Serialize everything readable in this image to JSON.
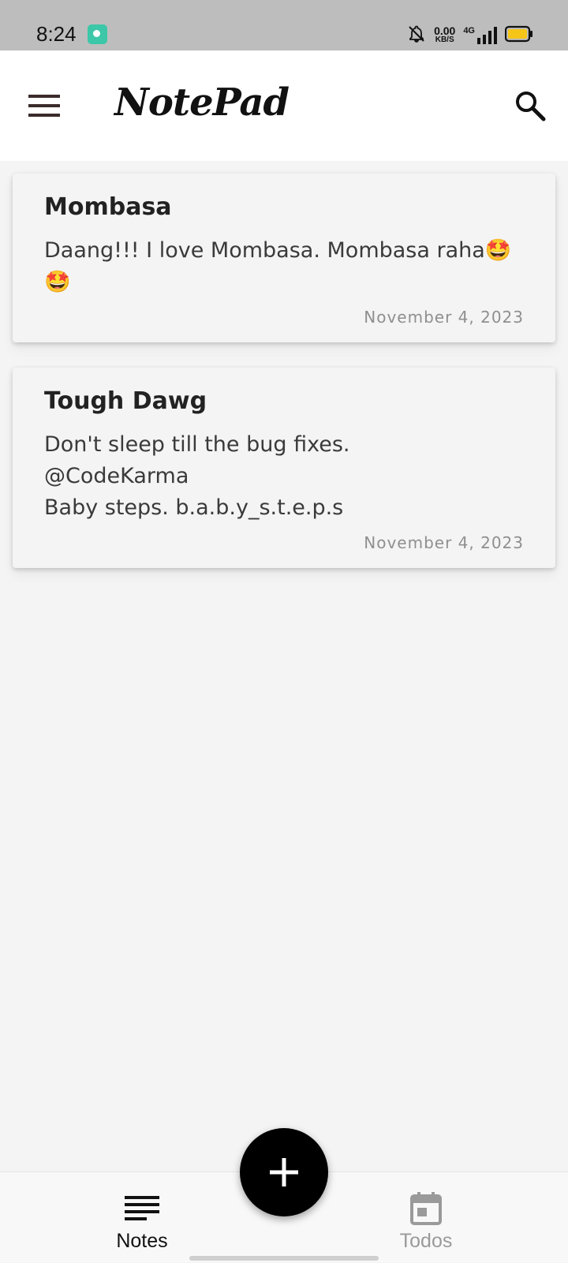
{
  "status_bar": {
    "time": "8:24",
    "net_speed_value": "0.00",
    "net_speed_unit": "KB/S",
    "network_type": "4G",
    "icons": [
      "app-notification-icon",
      "bell-off-icon",
      "signal-icon",
      "battery-icon"
    ],
    "battery_color": "#f5c518"
  },
  "app_bar": {
    "title": "NotePad",
    "menu_icon": "hamburger-menu-icon",
    "search_icon": "search-icon"
  },
  "notes": [
    {
      "title": "Mombasa",
      "body": "Daang!!! I love Mombasa. Mombasa raha🤩🤩",
      "date": "November 4, 2023"
    },
    {
      "title": "Tough Dawg",
      "body": "Don't sleep till the bug fixes.\n@CodeKarma\nBaby steps. b.a.b.y_s.t.e.p.s",
      "date": "November 4, 2023"
    }
  ],
  "fab": {
    "icon": "plus-icon"
  },
  "bottom_nav": {
    "items": [
      {
        "label": "Notes",
        "icon": "notes-lines-icon",
        "active": true
      },
      {
        "label": "Todos",
        "icon": "calendar-icon",
        "active": false
      }
    ]
  },
  "colors": {
    "background": "#f4f4f4",
    "status_bar": "#bdbdbd",
    "app_bar": "#ffffff",
    "fab": "#000000",
    "nav_active": "#111111",
    "nav_inactive": "#9a9a9a"
  }
}
